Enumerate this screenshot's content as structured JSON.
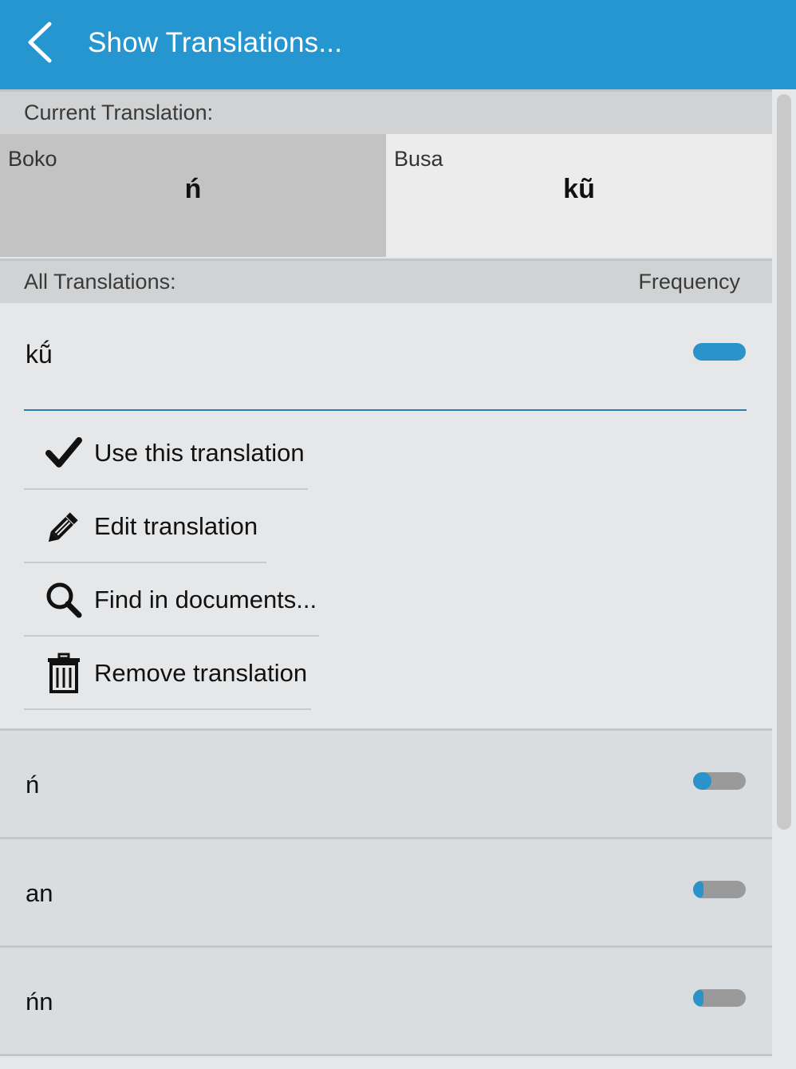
{
  "header": {
    "title": "Show Translations..."
  },
  "current_translation": {
    "label": "Current Translation:",
    "source": {
      "language": "Boko",
      "word": "ń"
    },
    "target": {
      "language": "Busa",
      "word": "kũ"
    }
  },
  "all_translations": {
    "label": "All Translations:",
    "frequency_label": "Frequency"
  },
  "expanded": {
    "word": "kṹ",
    "frequency": 1.0,
    "actions": [
      {
        "label": "Use this translation",
        "icon": "checkmark-icon"
      },
      {
        "label": "Edit translation",
        "icon": "pencil-icon"
      },
      {
        "label": "Find in documents...",
        "icon": "search-icon"
      },
      {
        "label": "Remove translation",
        "icon": "trash-icon"
      }
    ]
  },
  "rows": [
    {
      "word": "ń",
      "frequency": 0.35
    },
    {
      "word": "an",
      "frequency": 0.2
    },
    {
      "word": "ńn",
      "frequency": 0.2
    }
  ],
  "colors": {
    "header_bg": "#2596cf",
    "freq_fill": "#2a93c9",
    "freq_track": "#9a9a9a"
  }
}
